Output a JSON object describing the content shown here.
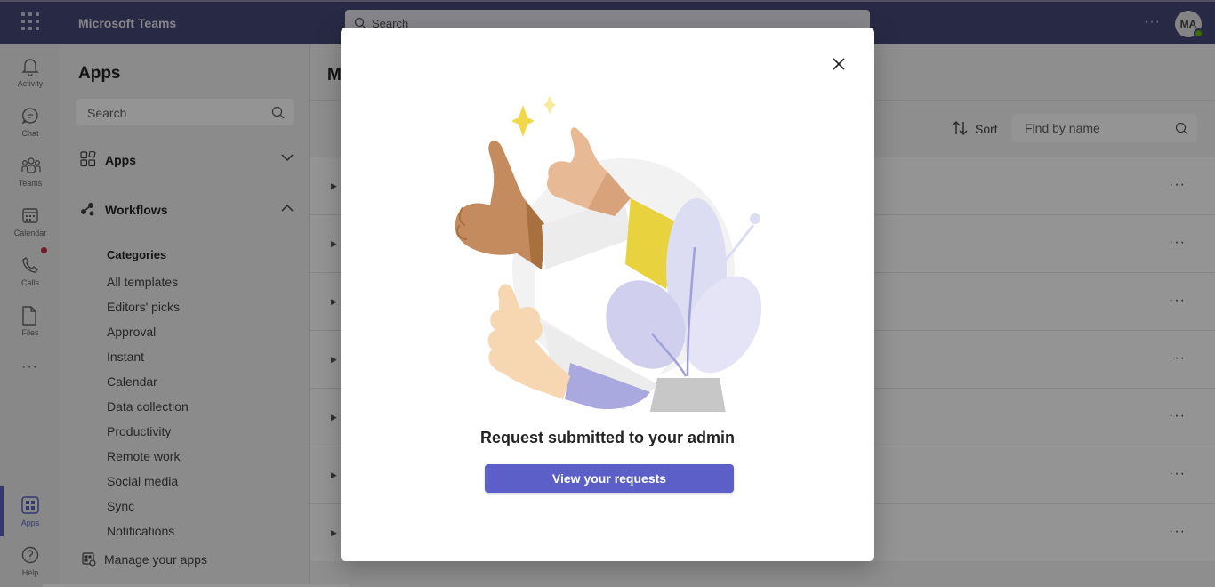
{
  "topbar": {
    "app_title": "Microsoft Teams",
    "search_placeholder": "Search",
    "avatar_initials": "MA"
  },
  "rail": {
    "items": [
      {
        "label": "Activity",
        "icon": "bell-icon"
      },
      {
        "label": "Chat",
        "icon": "chat-icon"
      },
      {
        "label": "Teams",
        "icon": "teams-icon"
      },
      {
        "label": "Calendar",
        "icon": "calendar-icon"
      },
      {
        "label": "Calls",
        "icon": "phone-icon"
      },
      {
        "label": "Files",
        "icon": "file-icon"
      },
      {
        "label": "Apps",
        "icon": "apps-icon"
      },
      {
        "label": "Help",
        "icon": "help-icon"
      }
    ]
  },
  "panel": {
    "title": "Apps",
    "search_placeholder": "Search",
    "sections": [
      {
        "label": "Apps",
        "expanded": false
      },
      {
        "label": "Workflows",
        "expanded": true
      }
    ],
    "categories_title": "Categories",
    "categories": [
      "All templates",
      "Editors' picks",
      "Approval",
      "Instant",
      "Calendar",
      "Data collection",
      "Productivity",
      "Remote work",
      "Social media",
      "Sync",
      "Notifications"
    ],
    "manage_label": "Manage your apps"
  },
  "main": {
    "title_partial": "M",
    "sort_label": "Sort",
    "find_placeholder": "Find by name",
    "row_count": 7
  },
  "dialog": {
    "title": "Request submitted to your admin",
    "primary_button": "View your requests"
  },
  "colors": {
    "topbar": "#464775",
    "accent": "#5b5fc7",
    "presence": "#6bb700"
  }
}
